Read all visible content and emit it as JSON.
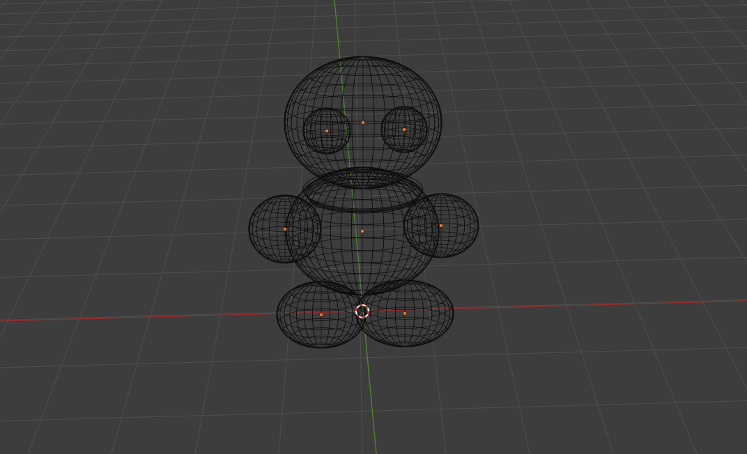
{
  "viewport": {
    "mode": "wireframe",
    "shading": "wireframe",
    "colors": {
      "background": "#3d3d3d",
      "grid": "#4f4f4f",
      "x_axis": "#9b2b2b",
      "y_axis": "#4e8a2a",
      "wire": "#0e0e0e",
      "origin": "#e8742a",
      "cursor_red": "#d93a3a",
      "cursor_white": "#f0f0f0"
    },
    "objects": [
      {
        "name": "head",
        "icon": "sphere-mesh"
      },
      {
        "name": "eye-left",
        "icon": "sphere-mesh"
      },
      {
        "name": "eye-right",
        "icon": "sphere-mesh"
      },
      {
        "name": "body",
        "icon": "sphere-mesh"
      },
      {
        "name": "arm-left",
        "icon": "sphere-mesh"
      },
      {
        "name": "arm-right",
        "icon": "sphere-mesh"
      },
      {
        "name": "foot-left",
        "icon": "sphere-mesh"
      },
      {
        "name": "foot-right",
        "icon": "sphere-mesh"
      }
    ],
    "cursor": {
      "icon": "3d-cursor-icon"
    }
  }
}
